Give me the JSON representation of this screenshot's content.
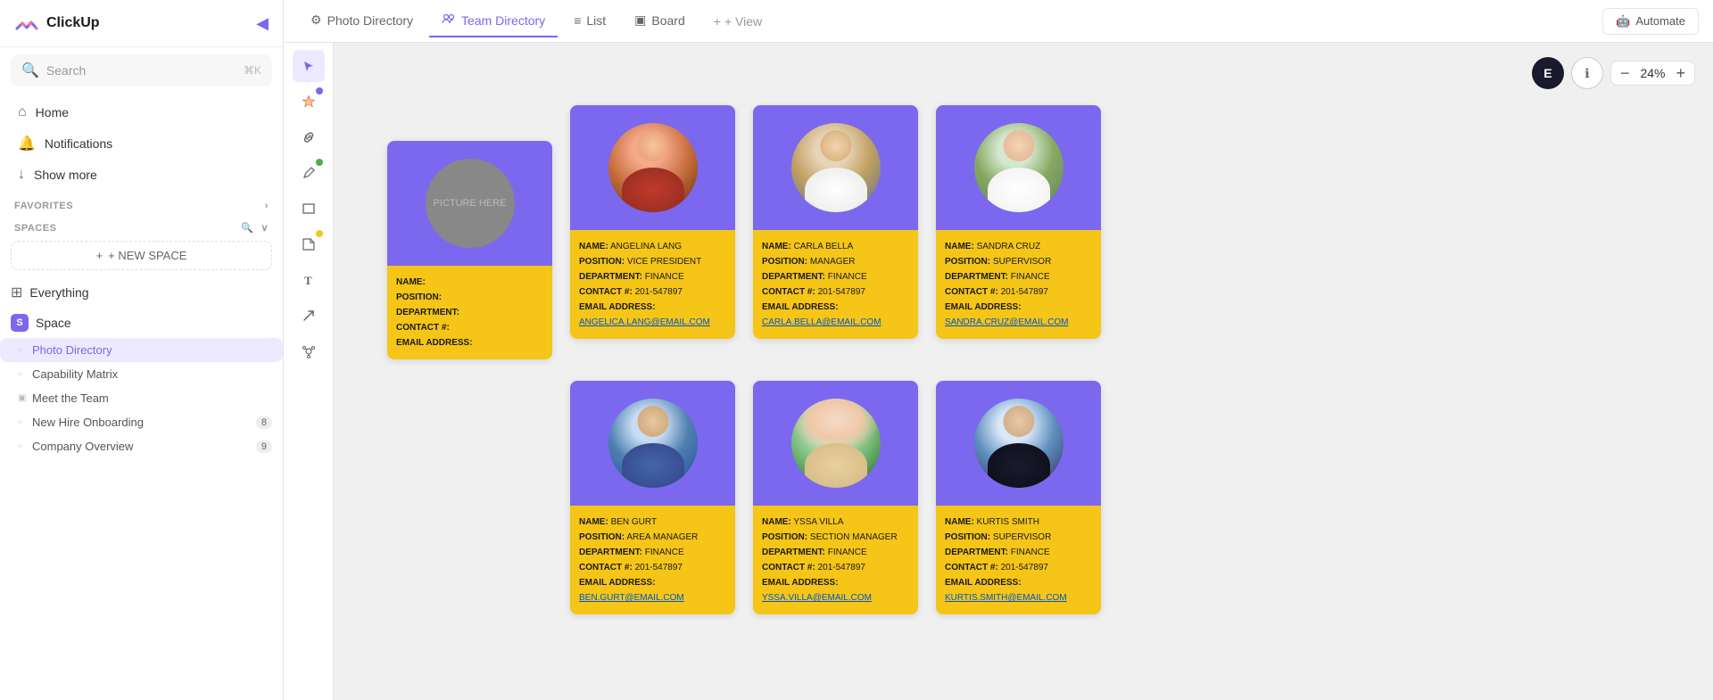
{
  "sidebar": {
    "logo_text": "ClickUp",
    "collapse_icon": "◀",
    "search": {
      "placeholder": "Search",
      "shortcut": "⌘K"
    },
    "nav": [
      {
        "id": "home",
        "label": "Home",
        "icon": "⌂"
      },
      {
        "id": "notifications",
        "label": "Notifications",
        "icon": "🔔"
      },
      {
        "id": "show-more",
        "label": "Show more",
        "icon": "↓"
      }
    ],
    "favorites_label": "FAVORITES",
    "spaces_label": "SPACES",
    "new_space_label": "+ NEW SPACE",
    "space": {
      "label": "Space",
      "badge": "S",
      "items": [
        {
          "id": "photo-directory",
          "label": "Photo Directory",
          "active": true,
          "type": "dot"
        },
        {
          "id": "capability-matrix",
          "label": "Capability Matrix",
          "active": false,
          "type": "dot"
        },
        {
          "id": "meet-the-team",
          "label": "Meet the Team",
          "active": false,
          "type": "doc"
        },
        {
          "id": "new-hire-onboarding",
          "label": "New Hire Onboarding",
          "active": false,
          "type": "dot",
          "count": 8
        },
        {
          "id": "company-overview",
          "label": "Company Overview",
          "active": false,
          "type": "dot",
          "count": 9
        }
      ]
    },
    "everything": {
      "label": "Everything"
    }
  },
  "tabs": [
    {
      "id": "photo-directory",
      "label": "Photo Directory",
      "icon": "⚙",
      "active": false
    },
    {
      "id": "team-directory",
      "label": "Team Directory",
      "icon": "🔗",
      "active": true
    },
    {
      "id": "list",
      "label": "List",
      "icon": "≡",
      "active": false
    },
    {
      "id": "board",
      "label": "Board",
      "icon": "▣",
      "active": false
    },
    {
      "id": "add-view",
      "label": "+ View",
      "active": false
    }
  ],
  "automate_label": "Automate",
  "zoom": {
    "level": "24%",
    "minus": "−",
    "plus": "+"
  },
  "avatar_initial": "E",
  "toolbar_tools": [
    {
      "id": "cursor",
      "icon": "▶",
      "active": true
    },
    {
      "id": "color-picker",
      "icon": "🎨",
      "dot": "#7b68ee"
    },
    {
      "id": "link",
      "icon": "🔗"
    },
    {
      "id": "pencil",
      "icon": "✏",
      "dot": "#4caf50"
    },
    {
      "id": "rectangle",
      "icon": "□"
    },
    {
      "id": "sticky-note",
      "icon": "📝",
      "dot": "#f5c518"
    },
    {
      "id": "text",
      "icon": "T"
    },
    {
      "id": "arrow",
      "icon": "↗"
    },
    {
      "id": "connections",
      "icon": "⊕"
    }
  ],
  "template_card": {
    "placeholder_text": "PICTURE HERE",
    "name_label": "NAME:",
    "position_label": "POSITION:",
    "department_label": "DEPARTMENT:",
    "contact_label": "CONTACT #:",
    "email_label": "EMAIL ADDRESS:"
  },
  "employees": [
    {
      "name": "ANGELINA LANG",
      "position": "VICE PRESIDENT",
      "department": "FINANCE",
      "contact": "201-547897",
      "email": "angelica.lang@email.com",
      "photo_class": "photo-angelina",
      "row": 0,
      "col": 0
    },
    {
      "name": "CARLA BELLA",
      "position": "MANAGER",
      "department": "FINANCE",
      "contact": "201-547897",
      "email": "carla.bella@email.com",
      "photo_class": "photo-carla",
      "row": 0,
      "col": 1
    },
    {
      "name": "SANDRA CRUZ",
      "position": "SUPERVISOR",
      "department": "FINANCE",
      "contact": "201-547897",
      "email": "sandra.cruz@email.com",
      "photo_class": "photo-sandra",
      "row": 0,
      "col": 2
    },
    {
      "name": "BEN GURT",
      "position": "AREA MANAGER",
      "department": "FINANCE",
      "contact": "201-547897",
      "email": "ben.gurt@email.com",
      "photo_class": "photo-ben",
      "row": 1,
      "col": 0
    },
    {
      "name": "YSSA VILLA",
      "position": "SECTION MANAGER",
      "department": "FINANCE",
      "contact": "201-547897",
      "email": "yssa.villa@email.com",
      "photo_class": "photo-yssa",
      "row": 1,
      "col": 1
    },
    {
      "name": "KURTIS SMITH",
      "position": "SUPERVISOR",
      "department": "FINANCE",
      "contact": "201-547897",
      "email": "kurtis.smith@email.com",
      "photo_class": "photo-kurtis",
      "row": 1,
      "col": 2
    }
  ],
  "field_labels": {
    "name": "NAME:",
    "position": "POSITION:",
    "department": "DEPARTMENT:",
    "contact": "CONTACT #:",
    "email": "EMAIL ADDRESS:"
  }
}
